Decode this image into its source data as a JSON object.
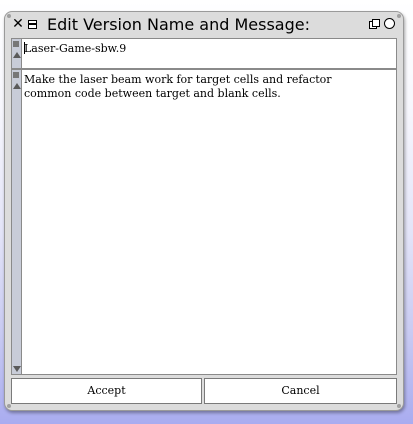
{
  "window": {
    "title": "Edit Version Name and Message:",
    "icons": [
      "close-icon",
      "window-menu-icon",
      "collapse-icon",
      "expand-icon"
    ]
  },
  "version_name": {
    "value": "Laser-Game-sbw.9"
  },
  "message": {
    "value": "Make the laser beam work for target cells and refactor\ncommon code between target and blank cells."
  },
  "buttons": {
    "accept_label": "Accept",
    "cancel_label": "Cancel"
  }
}
